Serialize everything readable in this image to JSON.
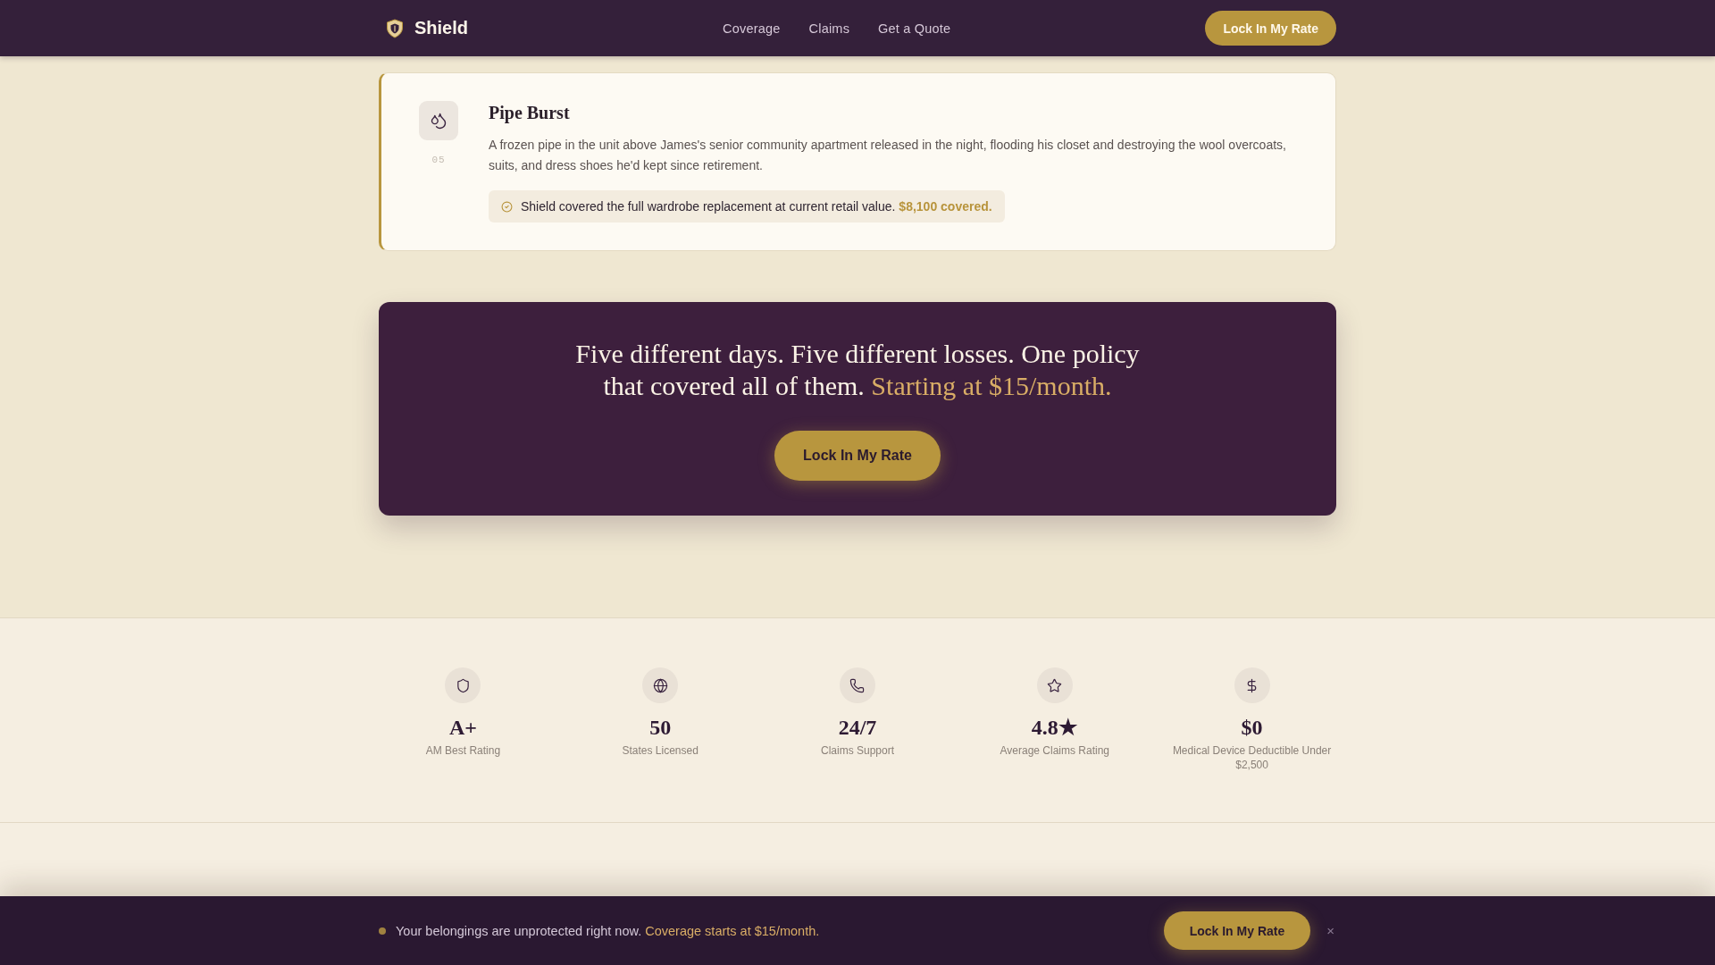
{
  "nav": {
    "brand": "Shield",
    "links": [
      {
        "label": "Coverage"
      },
      {
        "label": "Claims"
      },
      {
        "label": "Get a Quote"
      }
    ],
    "button": "Lock In My Rate"
  },
  "story": {
    "number": "05",
    "title": "Pipe Burst",
    "description": "A frozen pipe in the unit above James's senior community apartment released in the night, flooding his closet and destroying the wool overcoats, suits, and dress shoes he'd kept since retirement.",
    "outcome": "Shield covered the full wardrobe replacement at current retail value. **$8,100 covered.**"
  },
  "cta_banner": {
    "heading": "Five different days. Five different losses. One policy that covered all of them.",
    "highlight": "Starting at $15/month.",
    "button": "Lock In My Rate"
  },
  "stats": [
    {
      "value": "A+",
      "label": "AM Best Rating"
    },
    {
      "value": "50",
      "label": "States Licensed"
    },
    {
      "value": "24/7",
      "label": "Claims Support"
    },
    {
      "value": "4.8★",
      "label": "Average Claims Rating"
    },
    {
      "value": "$0",
      "label": "Medical Device Deductible Under $2,500"
    }
  ],
  "bottom_bar": {
    "message": "Your belongings are unprotected right now.",
    "highlight": "Coverage starts at $15/month.",
    "button": "Lock In My Rate",
    "close": "×"
  }
}
